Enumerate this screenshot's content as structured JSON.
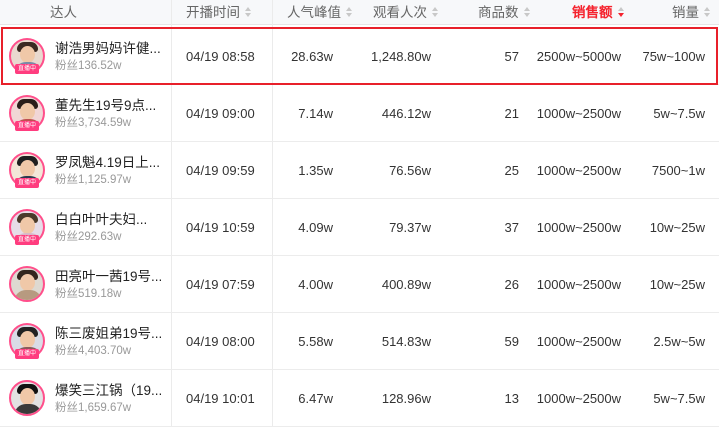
{
  "headers": {
    "influencer": "达人",
    "start_time": "开播时间",
    "peak_popularity": "人气峰值",
    "total_viewers": "观看人次",
    "product_count": "商品数",
    "sales_amount": "销售额",
    "sales_volume": "销量"
  },
  "rows": [
    {
      "name": "谢浩男妈妈许健...",
      "fans": "粉丝136.52w",
      "badge": "直播中",
      "time": "04/19 08:58",
      "peak": "28.63w",
      "viewers": "1,248.80w",
      "products": "57",
      "amount": "2500w~5000w",
      "volume": "75w~100w"
    },
    {
      "name": "董先生19号9点...",
      "fans": "粉丝3,734.59w",
      "badge": "直播中",
      "time": "04/19 09:00",
      "peak": "7.14w",
      "viewers": "446.12w",
      "products": "21",
      "amount": "1000w~2500w",
      "volume": "5w~7.5w"
    },
    {
      "name": "罗凤魁4.19日上...",
      "fans": "粉丝1,125.97w",
      "badge": "直播中",
      "time": "04/19 09:59",
      "peak": "1.35w",
      "viewers": "76.56w",
      "products": "25",
      "amount": "1000w~2500w",
      "volume": "7500~1w"
    },
    {
      "name": "白白叶叶夫妇...",
      "fans": "粉丝292.63w",
      "badge": "直播中",
      "time": "04/19 10:59",
      "peak": "4.09w",
      "viewers": "79.37w",
      "products": "37",
      "amount": "1000w~2500w",
      "volume": "10w~25w"
    },
    {
      "name": "田亮叶一茜19号...",
      "fans": "粉丝519.18w",
      "badge": "",
      "time": "04/19 07:59",
      "peak": "4.00w",
      "viewers": "400.89w",
      "products": "26",
      "amount": "1000w~2500w",
      "volume": "10w~25w"
    },
    {
      "name": "陈三废姐弟19号...",
      "fans": "粉丝4,403.70w",
      "badge": "直播中",
      "time": "04/19 08:00",
      "peak": "5.58w",
      "viewers": "514.83w",
      "products": "59",
      "amount": "1000w~2500w",
      "volume": "2.5w~5w"
    },
    {
      "name": "爆笑三江锅（19...",
      "fans": "粉丝1,659.67w",
      "badge": "",
      "time": "04/19 10:01",
      "peak": "6.47w",
      "viewers": "128.96w",
      "products": "13",
      "amount": "1000w~2500w",
      "volume": "5w~7.5w"
    }
  ],
  "colors": {
    "accent": "#f5222d",
    "highlight_border": "#e8202a",
    "live_badge": "#ff3d7f"
  }
}
